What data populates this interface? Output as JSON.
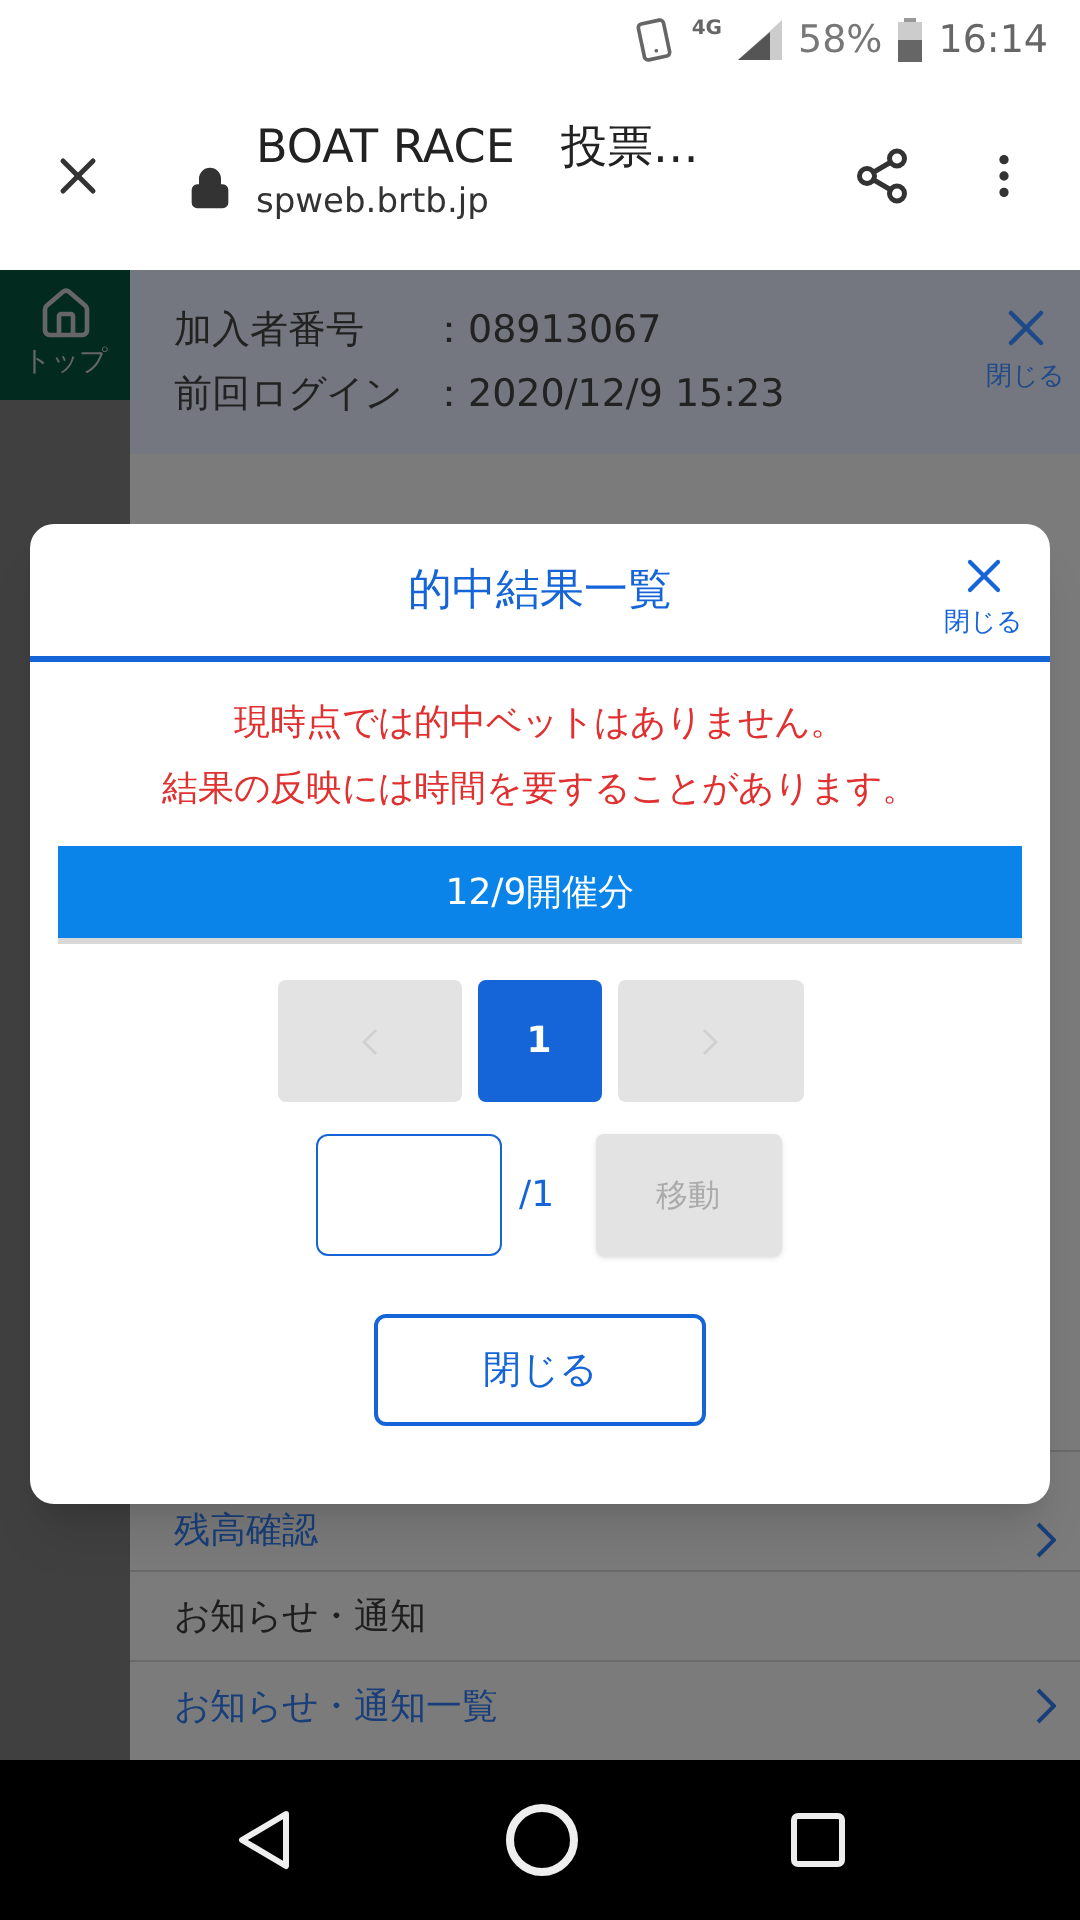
{
  "status_bar": {
    "network": "4G",
    "battery": "58%",
    "time": "16:14"
  },
  "browser": {
    "title": "BOAT RACE　投票…",
    "url": "spweb.brtb.jp"
  },
  "page": {
    "sidebar_top": "トップ",
    "member_info": [
      {
        "label": "加入者番号",
        "value": "：08913067"
      },
      {
        "label": "前回ログイン",
        "value": "：2020/12/9 15:23"
      }
    ],
    "close_label": "閉じる",
    "menu": [
      {
        "kind": "link",
        "text": "残高確認"
      },
      {
        "kind": "heading",
        "text": "お知らせ・通知"
      },
      {
        "kind": "link",
        "text": "お知らせ・通知一覧"
      }
    ]
  },
  "modal": {
    "title": "的中結果一覧",
    "close_label": "閉じる",
    "messages": [
      "現時点では的中ベットはありません。",
      "結果の反映には時間を要することがあります。"
    ],
    "date_header": "12/9開催分",
    "pagination": {
      "prev": {
        "disabled": true
      },
      "pages": [
        {
          "label": "1",
          "selected": true
        }
      ],
      "next": {
        "disabled": true
      }
    },
    "page_total": "/1",
    "move_button": {
      "label": "移動",
      "disabled": true
    },
    "close_button": "閉じる"
  }
}
